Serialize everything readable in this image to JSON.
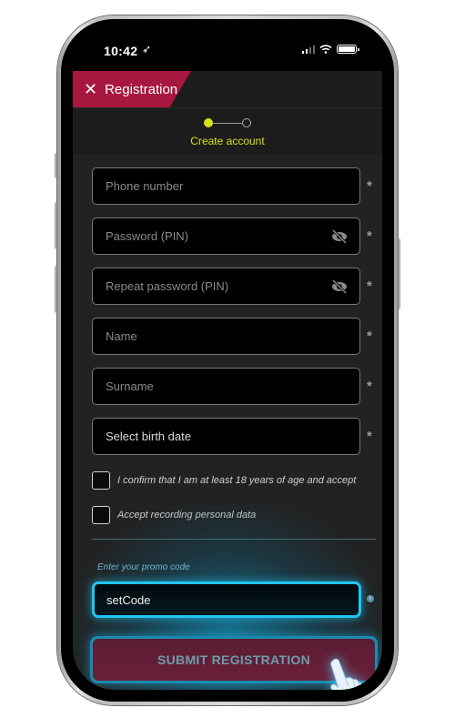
{
  "status_bar": {
    "time": "10:42",
    "location_icon": "location-arrow-icon",
    "signal_icon": "cellular-signal-icon",
    "wifi_icon": "wifi-icon",
    "battery_icon": "battery-icon"
  },
  "header": {
    "close_icon": "close-icon",
    "title": "Registration",
    "accent_color": "#a8173f"
  },
  "stepper": {
    "steps": [
      {
        "state": "active"
      },
      {
        "state": "inactive"
      }
    ],
    "current_label": "Create account",
    "active_color": "#d4e21a"
  },
  "form": {
    "fields": [
      {
        "placeholder": "Phone number",
        "required": "*"
      },
      {
        "placeholder": "Password (PIN)",
        "required": "*",
        "icon": "eye-off-icon"
      },
      {
        "placeholder": "Repeat password (PIN)",
        "required": "*",
        "icon": "eye-off-icon"
      },
      {
        "placeholder": "Name",
        "required": "*"
      },
      {
        "placeholder": "Surname",
        "required": "*"
      },
      {
        "placeholder": "Select birth date",
        "required": "*"
      }
    ],
    "checkboxes": [
      {
        "label": "I confirm that I am at least 18 years of age and accept",
        "checked": false
      },
      {
        "label": "Accept recording personal data",
        "checked": false
      }
    ],
    "promo": {
      "label": "Enter your promo code",
      "value": "setCode",
      "info_icon": "info-icon",
      "highlight_color": "#22c4f2"
    },
    "submit_label": "SUBMIT REGISTRATION"
  },
  "overlay": {
    "pointer_icon": "tap-hand-icon"
  }
}
